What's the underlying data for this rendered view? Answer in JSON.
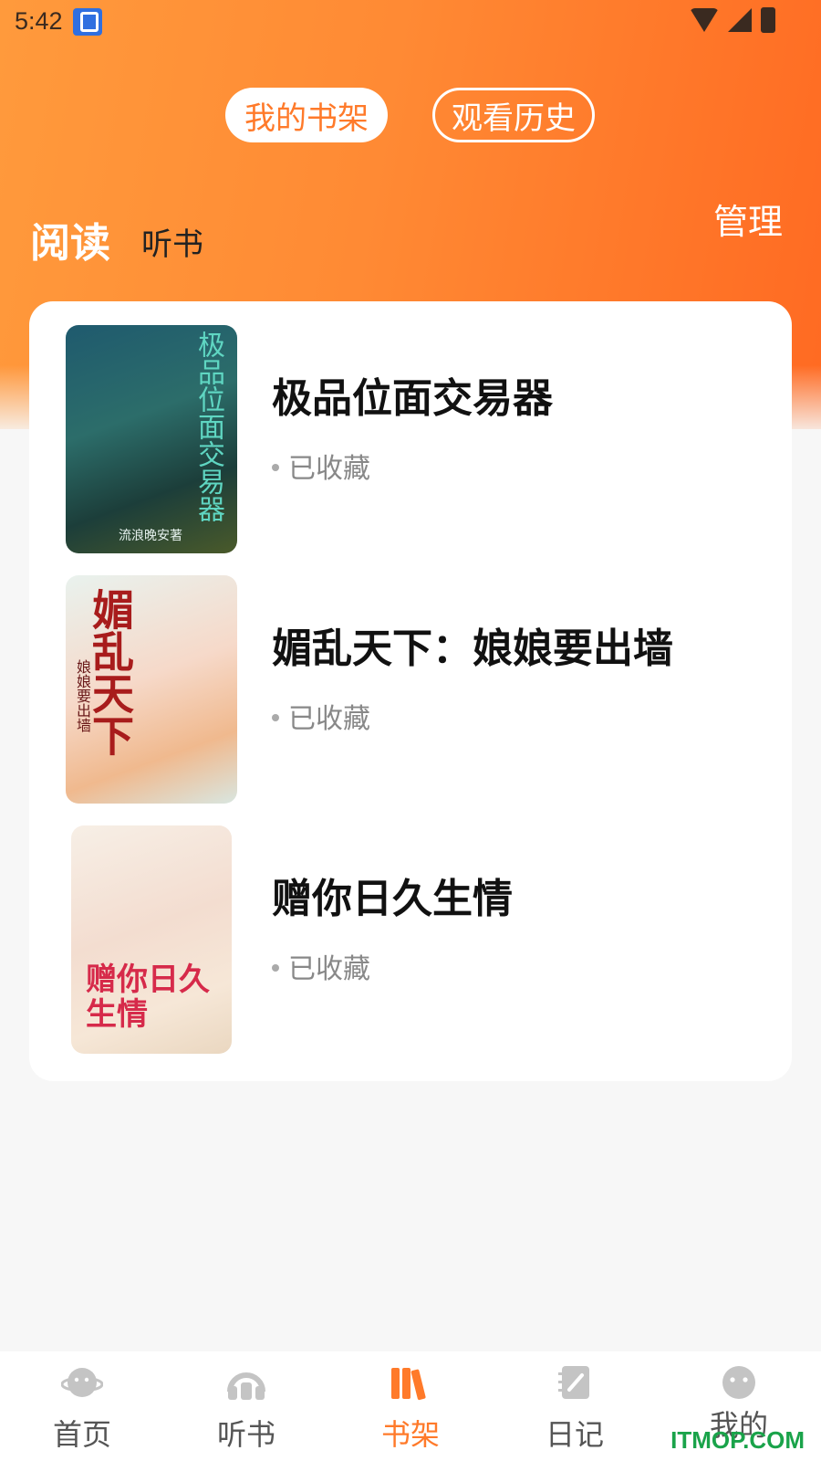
{
  "status_bar": {
    "time": "5:42"
  },
  "header": {
    "tabs": [
      {
        "label": "我的书架",
        "active": true
      },
      {
        "label": "观看历史",
        "active": false
      }
    ],
    "sub_tabs": [
      {
        "label": "阅读",
        "active": true
      },
      {
        "label": "听书",
        "active": false
      }
    ],
    "manage_label": "管理",
    "accent_color": "#ff7a2a"
  },
  "books": [
    {
      "title": "极品位面交易器",
      "status": "已收藏",
      "cover_text": "极品位面交易器",
      "cover_author": "流浪晚安著"
    },
    {
      "title": "媚乱天下：娘娘要出墙",
      "status": "已收藏",
      "cover_text": "媚乱天下",
      "cover_sub": "娘娘要出墙"
    },
    {
      "title": "赠你日久生情",
      "status": "已收藏",
      "cover_text": "赠你日久生情"
    }
  ],
  "bottom_nav": [
    {
      "label": "首页",
      "icon": "planet-icon",
      "active": false
    },
    {
      "label": "听书",
      "icon": "headphones-icon",
      "active": false
    },
    {
      "label": "书架",
      "icon": "books-icon",
      "active": true
    },
    {
      "label": "日记",
      "icon": "notebook-icon",
      "active": false
    },
    {
      "label": "我的",
      "icon": "face-icon",
      "active": false
    }
  ],
  "watermark": "ITMOP.COM"
}
